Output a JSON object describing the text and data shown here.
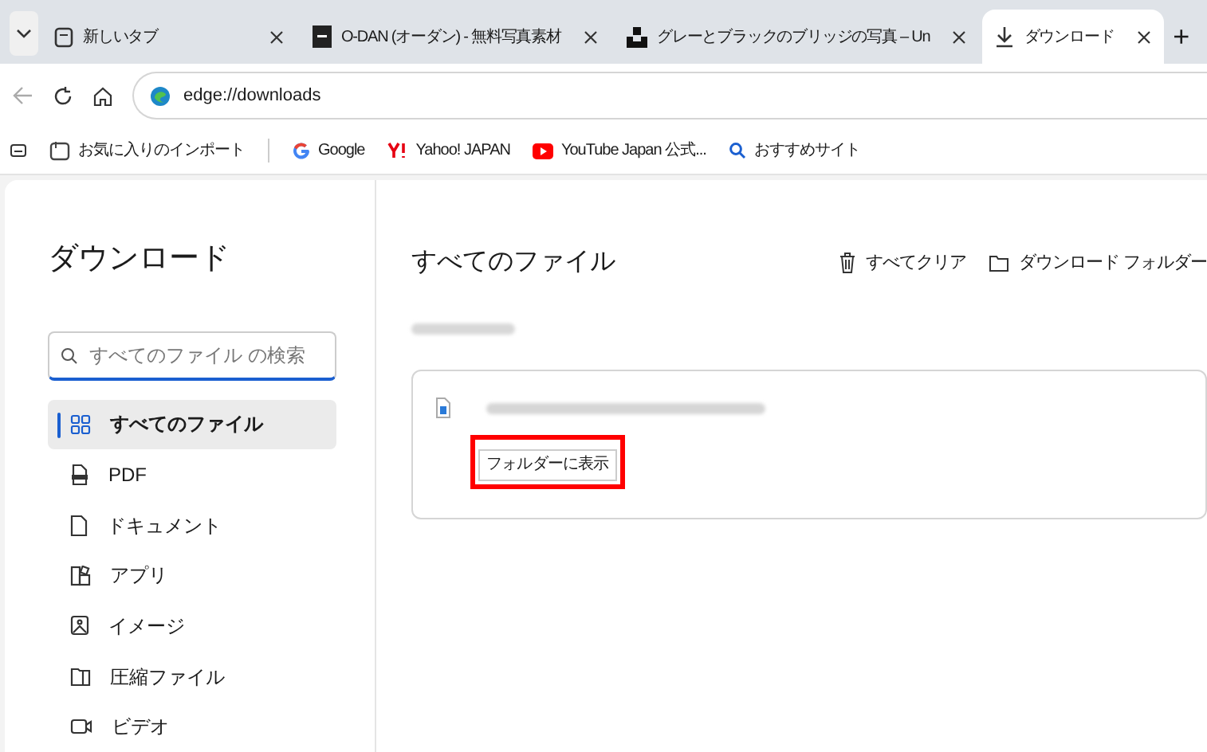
{
  "tabs": [
    {
      "title": "新しいタブ",
      "kind": "page",
      "selected": false
    },
    {
      "title": "O-DAN (オーダン) - 無料写真素材",
      "kind": "logo",
      "selected": false
    },
    {
      "title": "グレーとブラックのブリッジの写真 – Un",
      "kind": "logo2",
      "selected": false
    },
    {
      "title": "ダウンロード",
      "kind": "download",
      "selected": true
    }
  ],
  "new_tab": "+",
  "address": {
    "value": "edge://downloads"
  },
  "bookmarks": [
    {
      "label": "お気に入りのインポート",
      "kind": "import"
    },
    {
      "label": "Google",
      "kind": "google"
    },
    {
      "label": "Yahoo! JAPAN",
      "kind": "yahoo"
    },
    {
      "label": "YouTube Japan 公式...",
      "kind": "youtube"
    },
    {
      "label": "おすすめサイト",
      "kind": "search"
    }
  ],
  "sidebar": {
    "title": "ダウンロード",
    "search": {
      "placeholder": "すべてのファイル の検索"
    },
    "items": [
      {
        "label": "すべてのファイル",
        "kind": "grid",
        "selected": true
      },
      {
        "label": "PDF",
        "kind": "pdf",
        "selected": false
      },
      {
        "label": "ドキュメント",
        "kind": "doc",
        "selected": false
      },
      {
        "label": "アプリ",
        "kind": "app",
        "selected": false
      },
      {
        "label": "イメージ",
        "kind": "image",
        "selected": false
      },
      {
        "label": "圧縮ファイル",
        "kind": "zip",
        "selected": false
      },
      {
        "label": "ビデオ",
        "kind": "video",
        "selected": false
      }
    ]
  },
  "main": {
    "title": "すべてのファイル",
    "actions": [
      {
        "label": "すべてクリア",
        "kind": "trash"
      },
      {
        "label": "ダウンロード フォルダー",
        "kind": "folder"
      }
    ],
    "download": {
      "button": {
        "label": "フォルダーに表示",
        "highlighted": true
      }
    }
  }
}
